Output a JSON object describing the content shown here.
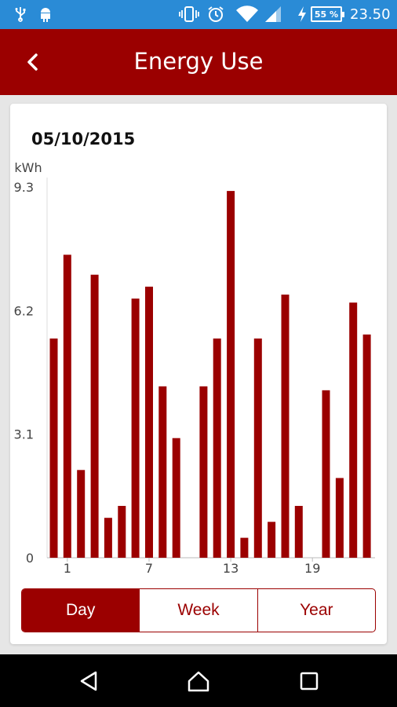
{
  "status_bar": {
    "icons": [
      "usb-icon",
      "android-icon",
      "vibrate-icon",
      "alarm-icon",
      "wifi-icon",
      "signal-icon",
      "charging-icon"
    ],
    "battery": "55 %",
    "time": "23.50"
  },
  "header": {
    "title": "Energy Use",
    "back_icon": "chevron-left-icon"
  },
  "date": "05/10/2015",
  "chart_data": {
    "type": "bar",
    "ylabel": "kWh",
    "ylim": [
      0,
      9.3
    ],
    "yticks": [
      "9.3",
      "6.2",
      "3.1",
      "0"
    ],
    "xticks": [
      {
        "x": 1,
        "label": "1"
      },
      {
        "x": 7,
        "label": "7"
      },
      {
        "x": 13,
        "label": "13"
      },
      {
        "x": 19,
        "label": "19"
      }
    ],
    "x": [
      0,
      1,
      2,
      3,
      4,
      5,
      6,
      7,
      8,
      9,
      10,
      11,
      12,
      13,
      14,
      15,
      16,
      17,
      18,
      19,
      20,
      21,
      22,
      23
    ],
    "values": [
      5.5,
      7.6,
      2.2,
      7.1,
      1.0,
      1.3,
      6.5,
      6.8,
      4.3,
      3.0,
      0,
      4.3,
      5.5,
      9.2,
      0.5,
      5.5,
      0.9,
      6.6,
      1.3,
      0,
      4.2,
      2.0,
      6.4,
      5.6
    ],
    "color": "#9b0000",
    "grid": false
  },
  "segment": {
    "options": [
      "Day",
      "Week",
      "Year"
    ],
    "selected": "Day"
  },
  "nav": {
    "back_icon": "nav-back-icon",
    "home_icon": "nav-home-icon",
    "recents_icon": "nav-recents-icon"
  },
  "colors": {
    "accent": "#9b0000",
    "status_bar": "#2a8bd6",
    "background": "#e6e6e6"
  }
}
